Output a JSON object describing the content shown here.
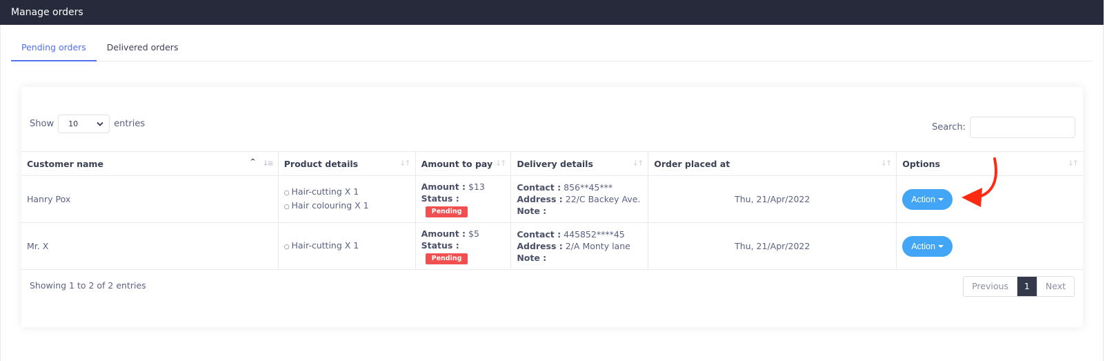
{
  "header": {
    "title": "Manage orders"
  },
  "tabs": [
    {
      "label": "Pending orders",
      "active": true
    },
    {
      "label": "Delivered orders",
      "active": false
    }
  ],
  "table_controls": {
    "show_label": "Show",
    "entries_label": "entries",
    "page_size": "10",
    "search_label": "Search:",
    "search_value": ""
  },
  "columns": [
    {
      "label": "Customer name",
      "sort": "ascending"
    },
    {
      "label": "Product details",
      "sort": "none"
    },
    {
      "label": "Amount to pay",
      "sort": "none"
    },
    {
      "label": "Delivery details",
      "sort": "none"
    },
    {
      "label": "Order placed at",
      "sort": "none"
    },
    {
      "label": "Options",
      "sort": "none"
    }
  ],
  "labels": {
    "amount": "Amount :",
    "status": "Status :",
    "contact": "Contact :",
    "address": "Address :",
    "note": "Note :",
    "action": "Action"
  },
  "rows": [
    {
      "customer": "Hanry Pox",
      "products": [
        "Hair-cutting X 1",
        "Hair colouring X 1"
      ],
      "amount": "$13",
      "status": "Pending",
      "contact": "856**45***",
      "address": "22/C Backey Ave.",
      "note": "",
      "placed_at": "Thu, 21/Apr/2022"
    },
    {
      "customer": "Mr. X",
      "products": [
        "Hair-cutting X 1"
      ],
      "amount": "$5",
      "status": "Pending",
      "contact": "445852****45",
      "address": "2/A Monty lane",
      "note": "",
      "placed_at": "Thu, 21/Apr/2022"
    }
  ],
  "footer": {
    "info": "Showing 1 to 2 of 2 entries",
    "previous": "Previous",
    "current_page": "1",
    "next": "Next"
  },
  "colors": {
    "topbar": "#262a3b",
    "accent": "#4f6ef2",
    "action_button": "#42a5f5",
    "pending_badge": "#f05050",
    "annotation_arrow": "#ff2a12"
  }
}
